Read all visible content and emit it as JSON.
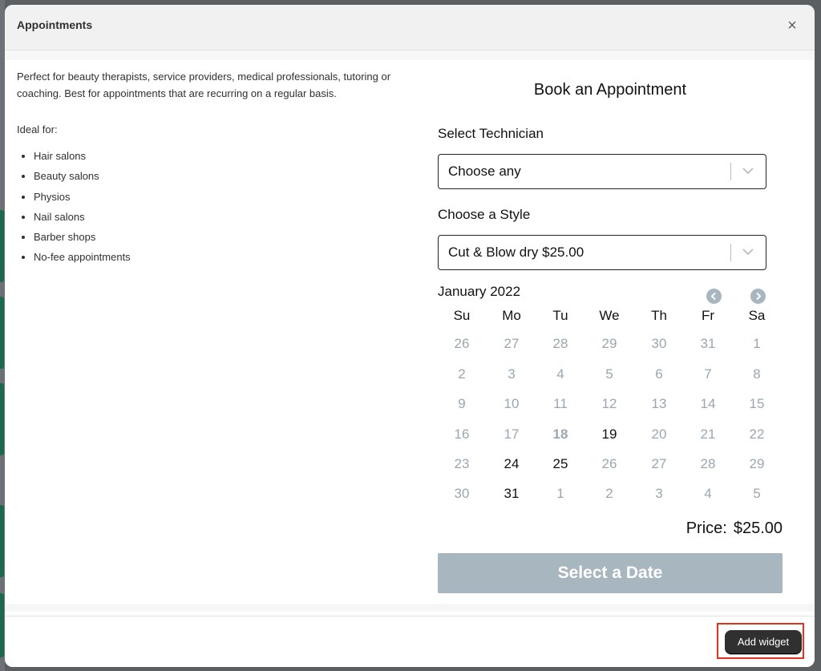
{
  "modal": {
    "title": "Appointments",
    "close_glyph": "×"
  },
  "description": {
    "text": "Perfect for beauty therapists, service providers, medical professionals, tutoring or coaching. Best for appointments that are recurring on a regular basis.",
    "ideal_heading": "Ideal for:",
    "items": [
      "Hair salons",
      "Beauty salons",
      "Physios",
      "Nail salons",
      "Barber shops",
      "No-fee appointments"
    ]
  },
  "widget": {
    "title": "Book an Appointment",
    "technician_label": "Select Technician",
    "technician_value": "Choose any",
    "style_label": "Choose a Style",
    "style_value": "Cut & Blow dry $25.00",
    "calendar": {
      "month": "January 2022",
      "weekdays": [
        "Su",
        "Mo",
        "Tu",
        "We",
        "Th",
        "Fr",
        "Sa"
      ],
      "weeks": [
        [
          "26",
          "27",
          "28",
          "29",
          "30",
          "31",
          "1"
        ],
        [
          "2",
          "3",
          "4",
          "5",
          "6",
          "7",
          "8"
        ],
        [
          "9",
          "10",
          "11",
          "12",
          "13",
          "14",
          "15"
        ],
        [
          "16",
          "17",
          "18",
          "19",
          "20",
          "21",
          "22"
        ],
        [
          "23",
          "24",
          "25",
          "26",
          "27",
          "28",
          "29"
        ],
        [
          "30",
          "31",
          "1",
          "2",
          "3",
          "4",
          "5"
        ]
      ],
      "available": [
        "3-3",
        "4-1",
        "4-2",
        "5-1"
      ],
      "today": "3-2"
    },
    "price_label": "Price:",
    "price_value": "$25.00",
    "submit_label": "Select a Date"
  },
  "footer": {
    "add_widget_label": "Add widget"
  },
  "colors": {
    "primary_button": "#303030",
    "disabled_submit": "#a8b6c0",
    "unavailable_day": "#9aa7b1",
    "highlight_border": "#e3321f"
  }
}
